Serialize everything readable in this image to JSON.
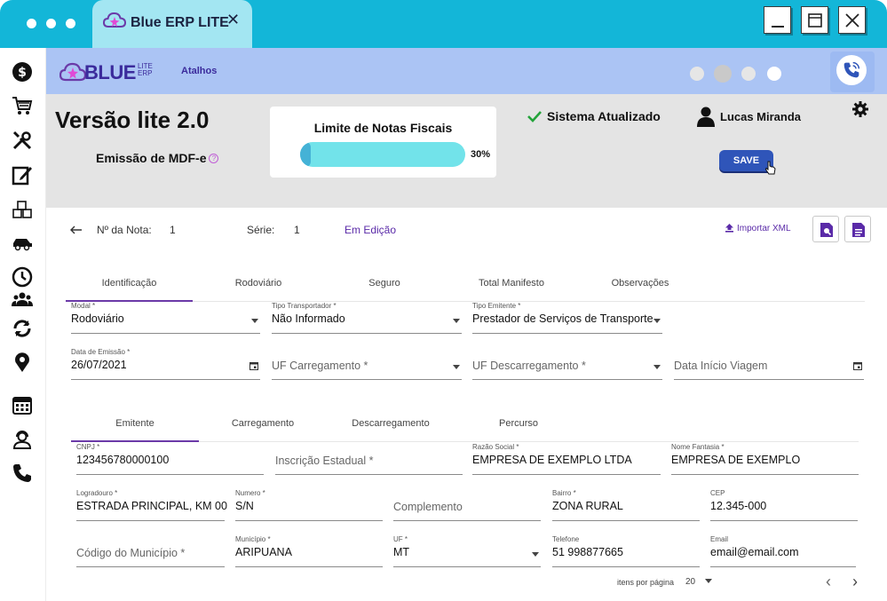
{
  "window": {
    "tab_title": "Blue ERP LITE",
    "tab_close": "✕"
  },
  "header": {
    "logo_text": "BLUE",
    "logo_sub_1": "LITE",
    "logo_sub_2": "ERP",
    "shortcuts_label": "Atalhos",
    "dot_colors": [
      "#e6e6e6",
      "#c9c9c9",
      "#e6e6e6",
      "#ffffff"
    ]
  },
  "panel": {
    "version": "Versão lite 2.0",
    "subtitle": "Emissão de MDF-e",
    "help_glyph": "?",
    "limit_title": "Limite de Notas Fiscais",
    "limit_percent": 30,
    "limit_label": "30%",
    "status_text": "Sistema Atualizado",
    "user_name": "Lucas Miranda",
    "save_label": "SAVE"
  },
  "document": {
    "number_label": "Nº da Nota:",
    "number_value": "1",
    "series_label": "Série:",
    "series_value": "1",
    "status": "Em Edição",
    "import_label": "Importar XML"
  },
  "tabs_main": [
    {
      "label": "Identificação",
      "active": true
    },
    {
      "label": "Rodoviário",
      "active": false
    },
    {
      "label": "Seguro",
      "active": false
    },
    {
      "label": "Total Manifesto",
      "active": false
    },
    {
      "label": "Observações",
      "active": false
    }
  ],
  "ident": {
    "modal": {
      "label": "Modal *",
      "value": "Rodoviário"
    },
    "tipo_transportador": {
      "label": "Tipo Transportador *",
      "value": "Não Informado"
    },
    "tipo_emitente": {
      "label": "Tipo Emitente *",
      "value": "Prestador de Serviços de Transporte"
    },
    "data_emissao": {
      "label": "Data de Emissão *",
      "value": "26/07/2021"
    },
    "uf_carregamento": {
      "placeholder": "UF Carregamento *"
    },
    "uf_descarregamento": {
      "placeholder": "UF Descarregamento *"
    },
    "data_inicio": {
      "placeholder": "Data Início Viagem"
    }
  },
  "tabs_sub": [
    {
      "label": "Emitente",
      "active": true
    },
    {
      "label": "Carregamento",
      "active": false
    },
    {
      "label": "Descarregamento",
      "active": false
    },
    {
      "label": "Percurso",
      "active": false
    }
  ],
  "emitente": {
    "cnpj": {
      "label": "CNPJ *",
      "value": "123456780000100"
    },
    "inscricao": {
      "placeholder": "Inscrição Estadual *"
    },
    "razao": {
      "label": "Razão Social *",
      "value": "EMPRESA DE EXEMPLO LTDA"
    },
    "fantasia": {
      "label": "Nome Fantasia *",
      "value": "EMPRESA DE EXEMPLO"
    },
    "logradouro": {
      "label": "Logradouro *",
      "value": "ESTRADA PRINCIPAL, KM 00"
    },
    "numero": {
      "label": "Numero *",
      "value": "S/N"
    },
    "complemento": {
      "placeholder": "Complemento"
    },
    "bairro": {
      "label": "Bairro *",
      "value": "ZONA RURAL"
    },
    "cep": {
      "label": "CEP",
      "value": "12.345-000"
    },
    "cod_municipio": {
      "placeholder": "Código do Município *"
    },
    "municipio": {
      "label": "Município *",
      "value": "ARIPUANA"
    },
    "uf": {
      "label": "UF *",
      "value": "MT"
    },
    "telefone": {
      "label": "Telefone",
      "value": "51 998877665"
    },
    "email": {
      "label": "Email",
      "value": "email@email.com"
    }
  },
  "pager": {
    "items_label": "itens por página",
    "items_value": "20",
    "prev": "‹",
    "next": "›"
  },
  "colors": {
    "titlebar": "#13b6d8",
    "header": "#abc4f4",
    "accent": "#5a2aa8",
    "save": "#2f55b9"
  }
}
